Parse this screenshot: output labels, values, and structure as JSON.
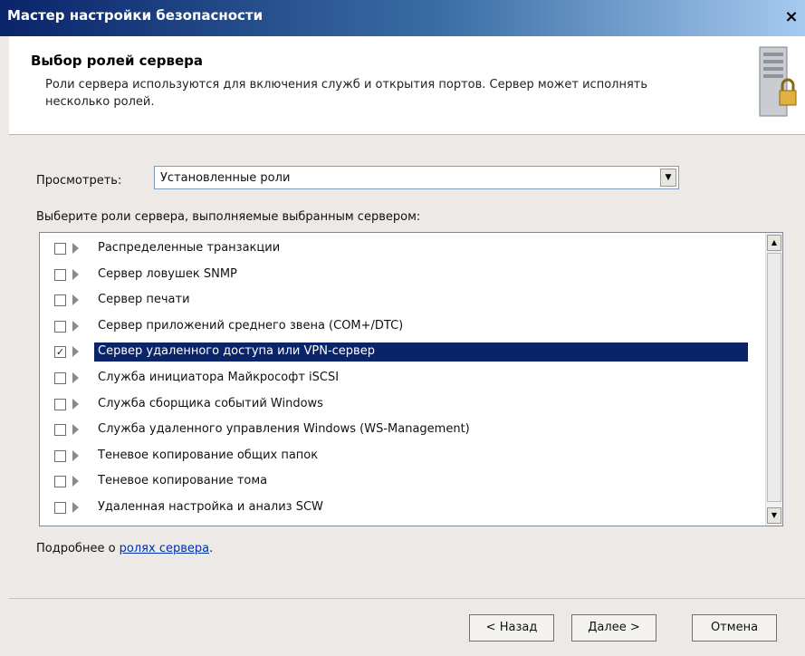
{
  "window": {
    "title": "Мастер настройки безопасности",
    "close_label": "×"
  },
  "header": {
    "title": "Выбор ролей сервера",
    "description": "Роли сервера используются для включения служб и открытия портов. Сервер может исполнять несколько ролей."
  },
  "view": {
    "label": "Просмотреть:",
    "selected": "Установленные роли"
  },
  "instruction": "Выберите роли сервера, выполняемые выбранным сервером:",
  "roles": [
    {
      "label": "Распределенные транзакции",
      "checked": false,
      "selected": false
    },
    {
      "label": "Сервер ловушек SNMP",
      "checked": false,
      "selected": false
    },
    {
      "label": "Сервер печати",
      "checked": false,
      "selected": false
    },
    {
      "label": "Сервер приложений среднего звена (COM+/DTC)",
      "checked": false,
      "selected": false
    },
    {
      "label": "Сервер удаленного доступа или VPN-сервер",
      "checked": true,
      "selected": true
    },
    {
      "label": "Служба инициатора Майкрософт iSCSI",
      "checked": false,
      "selected": false
    },
    {
      "label": "Служба сборщика событий Windows",
      "checked": false,
      "selected": false
    },
    {
      "label": "Служба удаленного управления Windows (WS-Management)",
      "checked": false,
      "selected": false
    },
    {
      "label": "Теневое копирование общих папок",
      "checked": false,
      "selected": false
    },
    {
      "label": "Теневое копирование тома",
      "checked": false,
      "selected": false
    },
    {
      "label": "Удаленная настройка и анализ SCW",
      "checked": false,
      "selected": false
    }
  ],
  "more": {
    "prefix": "Подробнее о ",
    "link": "ролях сервера",
    "suffix": "."
  },
  "buttons": {
    "back": "< Назад",
    "next": "Далее >",
    "cancel": "Отмена"
  },
  "icons": {
    "server": "server-lock-icon",
    "dropdown": "chevron-down-icon",
    "role": "role-arrow-icon"
  },
  "colors": {
    "selection": "#0a246a",
    "titlebar": "#0a246a"
  }
}
